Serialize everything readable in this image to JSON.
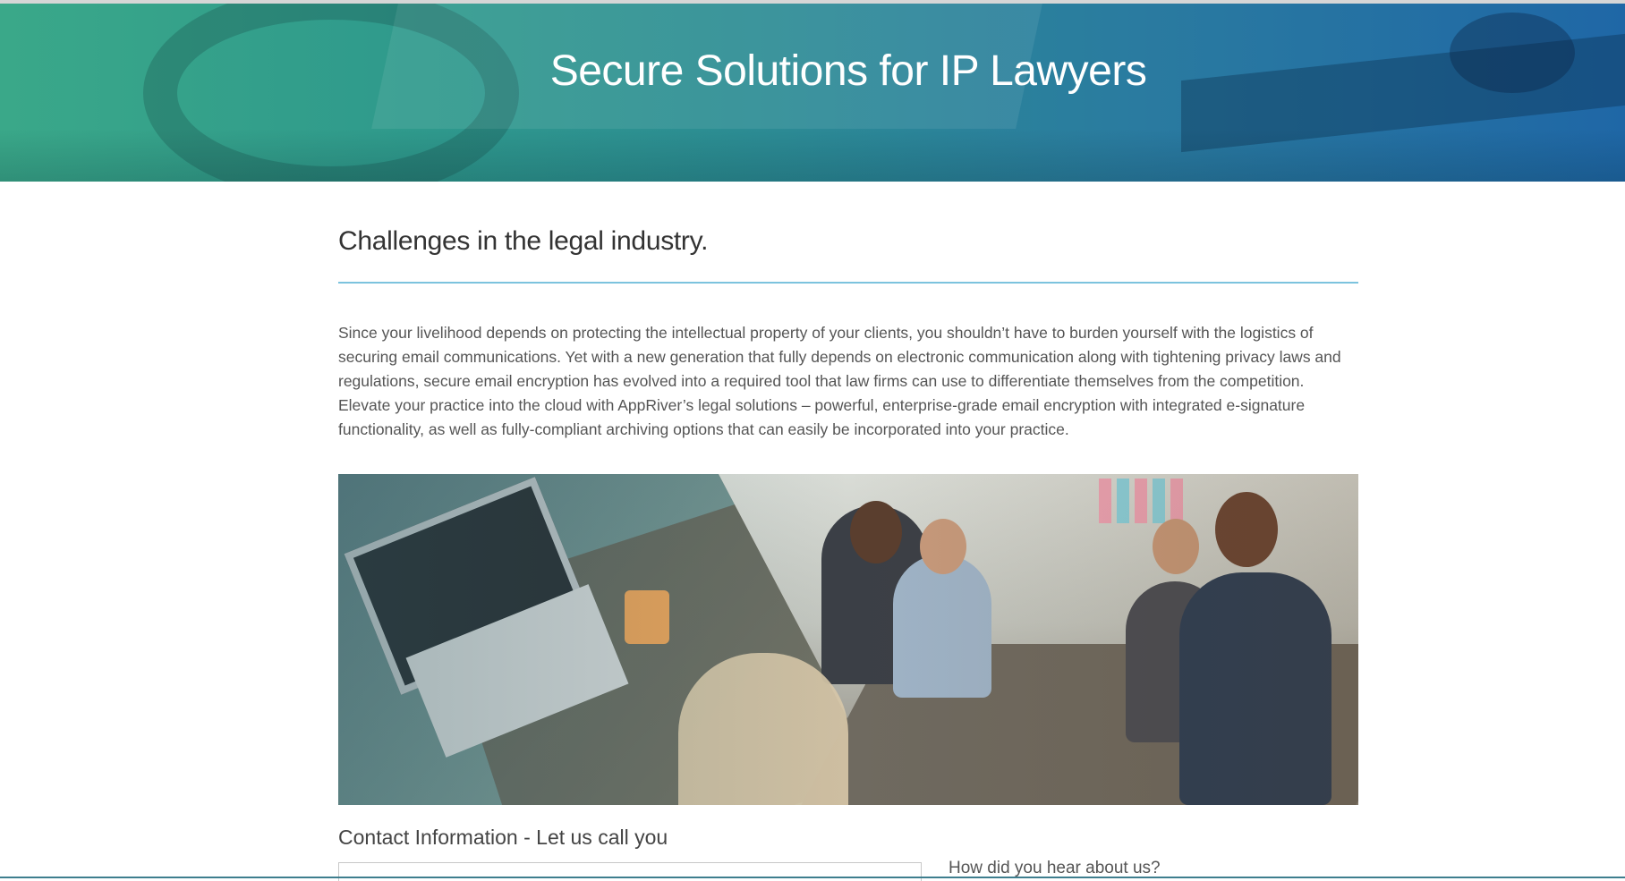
{
  "hero": {
    "title": "Secure Solutions for IP Lawyers"
  },
  "challenges": {
    "heading": "Challenges in the legal industry.",
    "body": "Since your livelihood depends on protecting the intellectual property of your clients, you shouldn’t have to burden yourself with the logistics of securing email communications.  Yet with a new generation that fully depends on electronic communication along with tightening privacy laws and regulations, secure email encryption has evolved into a required tool that law firms can use to differentiate themselves from the competition.  Elevate your practice into the cloud with AppRiver’s legal solutions – powerful, enterprise-grade email encryption with integrated e-signature functionality, as well as fully-compliant archiving options that can easily be incorporated into your practice."
  },
  "contact": {
    "heading": "Contact Information - Let us call you",
    "name_field_value": "",
    "hear_about_label": "How did you hear about us?"
  }
}
